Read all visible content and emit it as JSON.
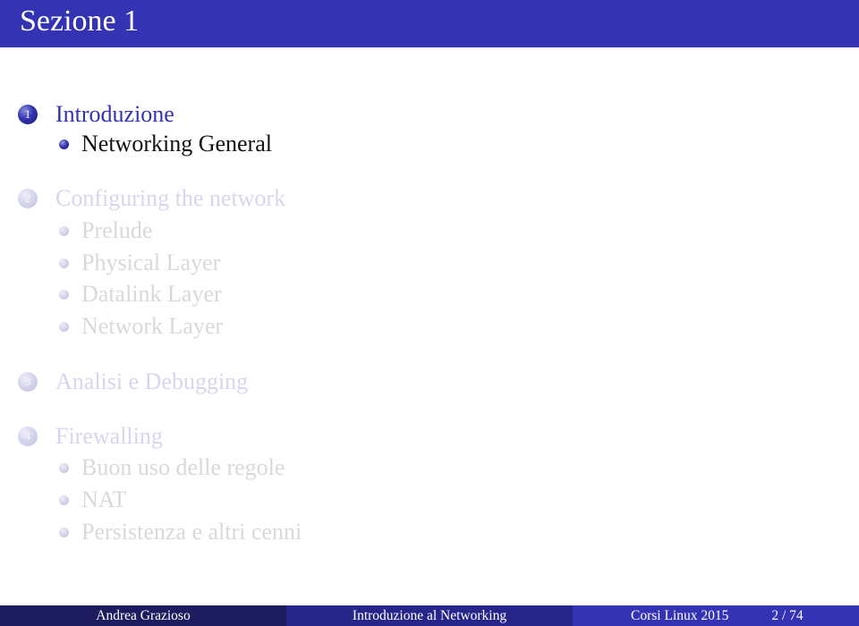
{
  "header": {
    "title": "Sezione 1"
  },
  "toc": {
    "sections": [
      {
        "number": "1",
        "label": "Introduzione",
        "state": "active",
        "subsections": [
          {
            "label": "Networking General",
            "state": "active"
          }
        ]
      },
      {
        "number": "2",
        "label": "Configuring the network",
        "state": "dim",
        "subsections": [
          {
            "label": "Prelude",
            "state": "dim"
          },
          {
            "label": "Physical Layer",
            "state": "dim"
          },
          {
            "label": "Datalink Layer",
            "state": "dim"
          },
          {
            "label": "Network Layer",
            "state": "dim"
          }
        ]
      },
      {
        "number": "3",
        "label": "Analisi e Debugging",
        "state": "dim",
        "subsections": []
      },
      {
        "number": "4",
        "label": "Firewalling",
        "state": "dim",
        "subsections": [
          {
            "label": "Buon uso delle regole",
            "state": "dim"
          },
          {
            "label": "NAT",
            "state": "dim"
          },
          {
            "label": "Persistenza e altri cenni",
            "state": "dim"
          }
        ]
      }
    ]
  },
  "footer": {
    "author": "Andrea Grazioso",
    "title": "Introduzione al Networking",
    "event": "Corsi Linux 2015",
    "page": "2 / 74"
  },
  "colors": {
    "accent": "#3333b3",
    "footer_dark": "#1c1c5e",
    "footer_mid": "#26268a",
    "dim_text": "#d9d9d9"
  }
}
